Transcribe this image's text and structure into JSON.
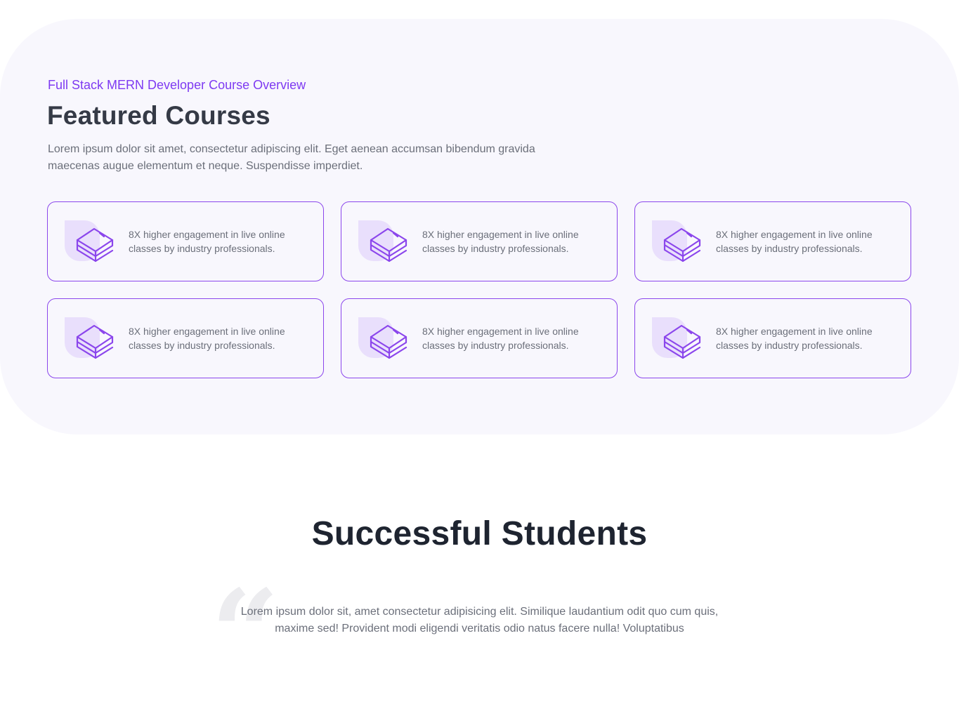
{
  "featured": {
    "eyebrow": "Full Stack MERN Developer Course Overview",
    "title": "Featured Courses",
    "description": "Lorem ipsum dolor sit amet, consectetur adipiscing elit. Eget aenean accumsan bibendum gravida maecenas augue elementum et neque. Suspendisse imperdiet.",
    "cards": [
      {
        "icon": "book-stack-icon",
        "text": "8X higher engagement in live online classes by industry professionals."
      },
      {
        "icon": "book-stack-icon",
        "text": "8X higher engagement in live online classes by industry professionals."
      },
      {
        "icon": "book-stack-icon",
        "text": "8X higher engagement in live online classes by industry professionals."
      },
      {
        "icon": "book-stack-icon",
        "text": "8X higher engagement in live online classes by industry professionals."
      },
      {
        "icon": "book-stack-icon",
        "text": "8X higher engagement in live online classes by industry professionals."
      },
      {
        "icon": "book-stack-icon",
        "text": "8X higher engagement in live online classes by industry professionals."
      }
    ]
  },
  "students": {
    "title": "Successful Students",
    "quote_icon": "quote-icon",
    "testimonial": "Lorem ipsum dolor sit, amet consectetur adipisicing elit. Similique laudantium odit quo cum quis, maxime sed! Provident modi eligendi veritatis odio natus facere nulla! Voluptatibus"
  },
  "colors": {
    "accent": "#7e3af2",
    "card_border": "#8b46ec",
    "section_bg": "#f8f7fd",
    "icon_blob": "#e9dffc"
  }
}
